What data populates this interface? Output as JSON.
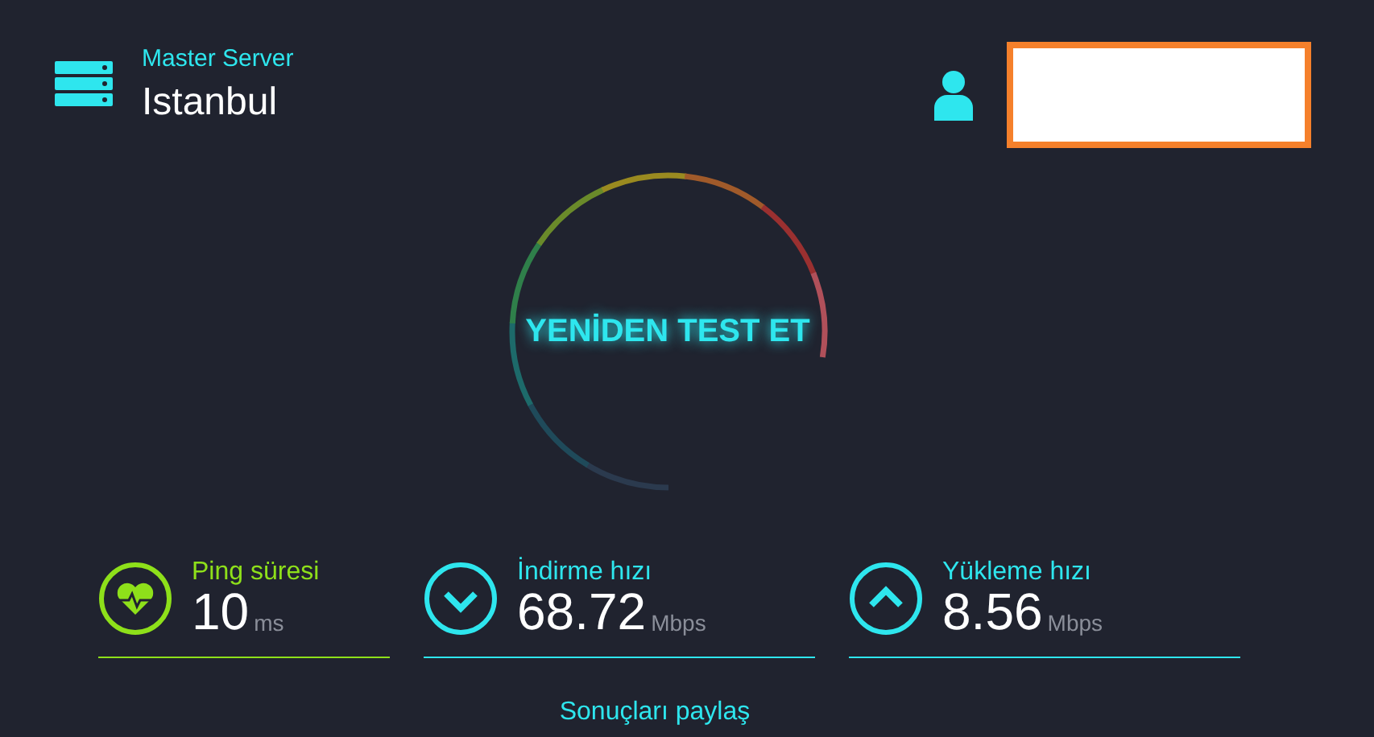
{
  "server": {
    "label": "Master Server",
    "city": "Istanbul"
  },
  "start_button": {
    "label": "YENİDEN TEST ET"
  },
  "metrics": [
    {
      "kind": "ping",
      "label": "Ping süresi",
      "value": "10",
      "unit": "ms",
      "color": "#8ee01a"
    },
    {
      "kind": "download",
      "label": "İndirme hızı",
      "value": "68.72",
      "unit": "Mbps",
      "color": "#2ee6ee"
    },
    {
      "kind": "upload",
      "label": "Yükleme hızı",
      "value": "8.56",
      "unit": "Mbps",
      "color": "#2ee6ee"
    }
  ],
  "share_link": {
    "label": "Sonuçları paylaş"
  }
}
